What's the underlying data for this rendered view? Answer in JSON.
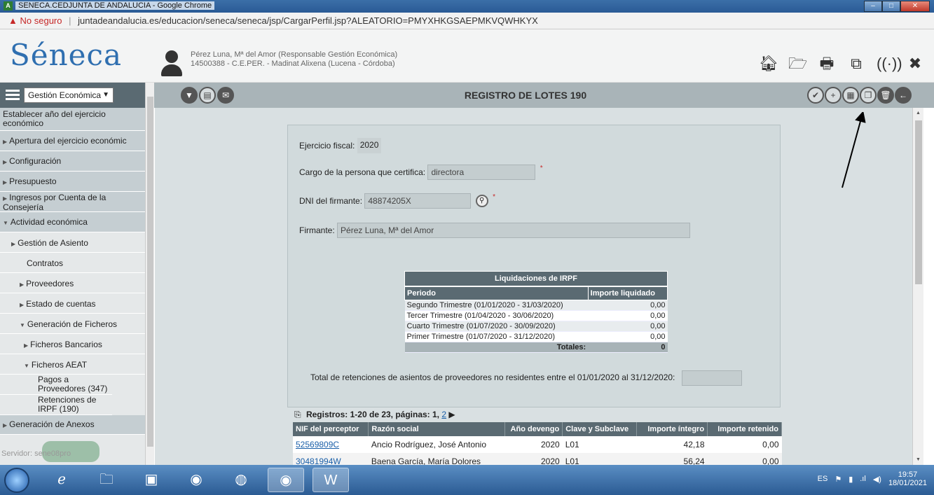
{
  "browser": {
    "window_title": "SENECA.CEDJUNTA DE ANDALUCIA - Google Chrome",
    "security_label": "No seguro",
    "url": "juntadeandalucia.es/educacion/seneca/seneca/jsp/CargarPerfil.jsp?ALEATORIO=PMYXHKGSAEPMKVQWHKYX"
  },
  "header": {
    "logo_text": "Séneca",
    "user_line1": "Pérez Luna, Mª del Amor (Responsable Gestión Económica)",
    "user_line2": "14500388 - C.E.PER. - Madinat Alixena (Lucena - Córdoba)",
    "icons": [
      "home-icon",
      "folder-icon",
      "print-icon",
      "copy-window-icon",
      "audio-icon",
      "close-icon"
    ]
  },
  "toolbar": {
    "module_select_value": "Gestión Económica",
    "page_title": "REGISTRO DE LOTES 190",
    "left_icons": [
      "filter-icon",
      "pdf-icon",
      "mail-icon"
    ],
    "right_icons": [
      "confirm-icon",
      "add-icon",
      "calculator-icon",
      "documents-icon",
      "delete-icon",
      "back-icon"
    ]
  },
  "sidebar": {
    "items": [
      {
        "label": "Establecer año del ejercicio económico",
        "level": 0,
        "arrow": ""
      },
      {
        "label": "Apertura del ejercicio económic",
        "level": 0,
        "arrow": "▶"
      },
      {
        "label": "Configuración",
        "level": 0,
        "arrow": "▶"
      },
      {
        "label": "Presupuesto",
        "level": 0,
        "arrow": "▶"
      },
      {
        "label": "Ingresos por Cuenta de la Consejería",
        "level": 0,
        "arrow": "▶"
      },
      {
        "label": "Actividad económica",
        "level": 0,
        "arrow": "▼"
      },
      {
        "label": "Gestión de Asiento",
        "level": 1,
        "arrow": "▶"
      },
      {
        "label": "Contratos",
        "level": 1,
        "arrow": ""
      },
      {
        "label": "Proveedores",
        "level": 1,
        "arrow": "▶"
      },
      {
        "label": "Estado de cuentas",
        "level": 1,
        "arrow": "▶"
      },
      {
        "label": "Generación de Ficheros",
        "level": 1,
        "arrow": "▼"
      },
      {
        "label": "Ficheros Bancarios",
        "level": 1,
        "arrow": "▶"
      },
      {
        "label": "Ficheros AEAT",
        "level": 1,
        "arrow": "▼"
      },
      {
        "label": "Pagos a Proveedores (347)",
        "level": 2,
        "arrow": ""
      },
      {
        "label": "Retenciones de IRPF (190)",
        "level": 2,
        "arrow": ""
      },
      {
        "label": "Generación de Anexos",
        "level": 0,
        "arrow": "▶"
      }
    ],
    "server_label": "Servidor: sene08pro"
  },
  "form": {
    "ejercicio_label": "Ejercicio fiscal:",
    "ejercicio_value": "2020",
    "cargo_label": "Cargo de la persona que certifica:",
    "cargo_value": "directora",
    "dni_label": "DNI del firmante:",
    "dni_value": "48874205X",
    "firmante_label": "Firmante:",
    "firmante_value": "Pérez Luna, Mª del Amor",
    "required_mark": "*"
  },
  "irpf": {
    "caption": "Liquidaciones de IRPF",
    "col_periodo": "Periodo",
    "col_importe": "Importe liquidado",
    "rows": [
      {
        "periodo": "Segundo Trimestre (01/01/2020 - 31/03/2020)",
        "importe": "0,00"
      },
      {
        "periodo": "Tercer Trimestre (01/04/2020 - 30/06/2020)",
        "importe": "0,00"
      },
      {
        "periodo": "Cuarto Trimestre (01/07/2020 - 30/09/2020)",
        "importe": "0,00"
      },
      {
        "periodo": "Primer Trimestre (01/07/2020 - 31/12/2020)",
        "importe": "0,00"
      }
    ],
    "totals_label": "Totales:",
    "totals_value": "0"
  },
  "retention": {
    "label": "Total de retenciones de asientos de proveedores no residentes entre el 01/01/2020 al 31/12/2020:"
  },
  "pager": {
    "text": "Registros: 1-20 de 23, páginas: 1,",
    "page_link": "2"
  },
  "records": {
    "columns": [
      "NIF del perceptor",
      "Razón social",
      "Año devengo",
      "Clave y Subclave",
      "Importe íntegro",
      "Importe retenido"
    ],
    "rows": [
      {
        "nif": "52569809C",
        "razon": "Ancio Rodríguez, José Antonio",
        "anio": "2020",
        "clave": "L01",
        "integro": "42,18",
        "retenido": "0,00"
      },
      {
        "nif": "30481994W",
        "razon": "Baena García, María Dolores",
        "anio": "2020",
        "clave": "L01",
        "integro": "56,24",
        "retenido": "0,00"
      }
    ]
  },
  "taskbar": {
    "lang": "ES",
    "time": "19:57",
    "date": "18/01/2021"
  }
}
